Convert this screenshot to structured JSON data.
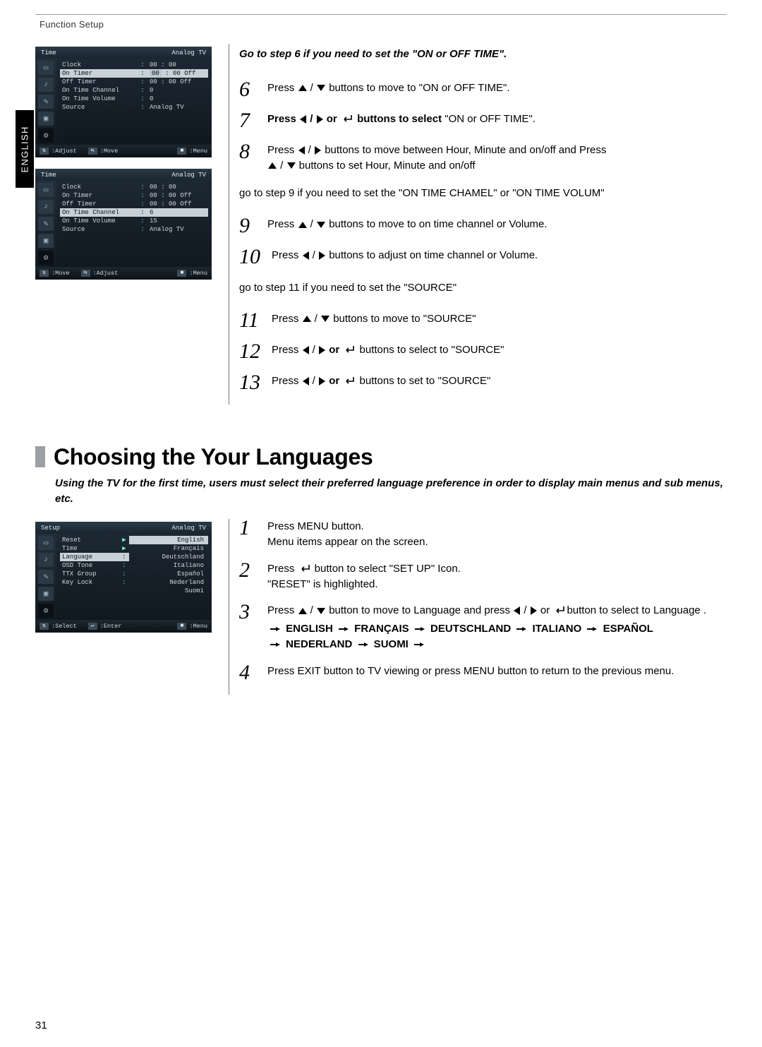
{
  "header": {
    "section": "Function Setup"
  },
  "lang_tab": "ENGLISH",
  "page_number": "31",
  "menu1": {
    "title_left": "Time",
    "title_right": "Analog TV",
    "rows": [
      {
        "label": "Clock",
        "col": ":",
        "value": "00 : 00"
      },
      {
        "label": "On Timer",
        "col": ":",
        "value": "00 : 00 Off",
        "hl": true,
        "pillFirst": true
      },
      {
        "label": "Off Timer",
        "col": ":",
        "value": "00 : 00 Off"
      },
      {
        "label": "On Time Channel",
        "col": ":",
        "value": "0"
      },
      {
        "label": "On Time Volume",
        "col": ":",
        "value": "0"
      },
      {
        "label": "Source",
        "col": ":",
        "value": "Analog TV"
      }
    ],
    "footer": {
      "l": ":Adjust",
      "m": ":Move",
      "r": ":Menu"
    }
  },
  "menu2": {
    "title_left": "Time",
    "title_right": "Analog TV",
    "rows": [
      {
        "label": "Clock",
        "col": ":",
        "value": "00 : 00"
      },
      {
        "label": "On Timer",
        "col": ":",
        "value": "00 : 00 Off"
      },
      {
        "label": "Off Timer",
        "col": ":",
        "value": "00 : 00 Off"
      },
      {
        "label": "On Time Channel",
        "col": ":",
        "value": "6",
        "hl": true
      },
      {
        "label": "On Time Volume",
        "col": ":",
        "value": "15"
      },
      {
        "label": "Source",
        "col": ":",
        "value": "Analog TV"
      }
    ],
    "footer": {
      "l": ":Move",
      "m": ":Adjust",
      "r": ":Menu"
    }
  },
  "menu3": {
    "title_left": "Setup",
    "title_right": "Analog TV",
    "rows": [
      {
        "label": "Reset",
        "col": "",
        "arrow": true
      },
      {
        "label": "Time",
        "col": "",
        "arrow": true
      },
      {
        "label": "Language",
        "col": ":",
        "hl": true
      },
      {
        "label": "OSD Tone",
        "col": ":"
      },
      {
        "label": "TTX Group",
        "col": ":"
      },
      {
        "label": "Key Lock",
        "col": ":"
      }
    ],
    "langs": [
      "English",
      "Français",
      "Deutschland",
      "Italiano",
      "Español",
      "Nederland",
      "Suomi"
    ],
    "footer": {
      "l": ":Select",
      "m": ":Enter",
      "r": ":Menu"
    }
  },
  "steps_top": {
    "intro": "Go to step 6 if you need to set the \"ON or OFF TIME\".",
    "s6": {
      "pre": "Press ",
      "mid": " buttons to move to \"ON or OFF TIME\"."
    },
    "s7": {
      "pre": "Press ",
      "mid": " or ",
      "tail": " buttons to select ",
      "end": "\"ON or OFF TIME\"."
    },
    "s8": {
      "line1a": "Press ",
      "line1b": " buttons to move between Hour, Minute and on/off and Press",
      "line2a": " buttons to set Hour, Minute and on/off"
    },
    "note1": "go to step 9 if you need to set the \"ON TIME CHAMEL\" or \"ON TIME VOLUM\"",
    "s9": {
      "pre": "Press ",
      "mid": " buttons to move to on time channel or Volume."
    },
    "s10": {
      "pre": "Press ",
      "mid": " buttons to adjust on time channel or Volume."
    },
    "note2": "go to step 11 if you need to set the \"SOURCE\"",
    "s11": {
      "pre": "Press ",
      "mid": " buttons to move to \"SOURCE\""
    },
    "s12": {
      "pre": "Press ",
      "mid": " or ",
      "tail": "  buttons to select  to \"SOURCE\""
    },
    "s13": {
      "pre": "Press ",
      "mid": " or ",
      "tail": "  buttons to set  to \"SOURCE\""
    }
  },
  "section2": {
    "heading": "Choosing the Your Languages",
    "intro": "Using the TV for the first time, users must select their preferred language preference in order to display main menus and sub menus, etc.",
    "s1": {
      "l1": "Press MENU button.",
      "l2": "Menu items appear on the screen."
    },
    "s2": {
      "l1a": "Press ",
      "l1b": " button to select \"SET UP\" Icon.",
      "l2": "\"RESET\" is highlighted."
    },
    "s3": {
      "l1a": "Press ",
      "l1b": " button to move to Language and press ",
      "l1c": " or ",
      "l1d": "button to select  to  Language ."
    },
    "langs": [
      "ENGLISH",
      "FRANÇAIS",
      "DEUTSCHLAND",
      "ITALIANO",
      "ESPAÑOL",
      "NEDERLAND",
      "SUOMI"
    ],
    "s4": "Press EXIT button to TV viewing or press MENU button to return to the previous menu."
  }
}
